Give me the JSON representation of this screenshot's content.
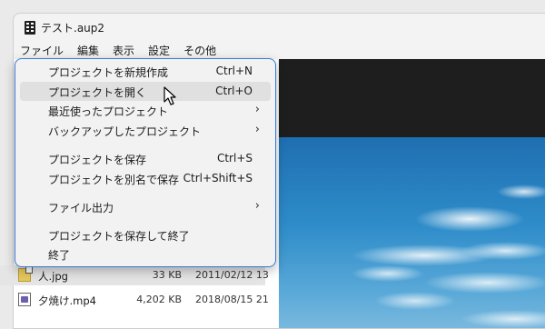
{
  "window": {
    "title": "テスト.aup2"
  },
  "menubar": {
    "items": [
      "ファイル",
      "編集",
      "表示",
      "設定",
      "その他"
    ]
  },
  "file_menu": {
    "new_project": {
      "label": "プロジェクトを新規作成",
      "shortcut": "Ctrl+N"
    },
    "open_project": {
      "label": "プロジェクトを開く",
      "shortcut": "Ctrl+O"
    },
    "recent_projects": {
      "label": "最近使ったプロジェクト",
      "arrow": "›"
    },
    "backup_projects": {
      "label": "バックアップしたプロジェクト",
      "arrow": "›"
    },
    "save_project": {
      "label": "プロジェクトを保存",
      "shortcut": "Ctrl+S"
    },
    "save_as": {
      "label": "プロジェクトを別名で保存",
      "shortcut": "Ctrl+Shift+S"
    },
    "file_export": {
      "label": "ファイル出力",
      "arrow": "›"
    },
    "save_and_exit": {
      "label": "プロジェクトを保存して終了"
    },
    "exit": {
      "label": "終了"
    }
  },
  "files": [
    {
      "name": "人.jpg",
      "size": "33 KB",
      "date": "2011/02/12 13",
      "icon": "jpg-file-icon"
    },
    {
      "name": "夕焼け.mp4",
      "size": "4,202 KB",
      "date": "2018/08/15 21",
      "icon": "mp4-file-icon"
    }
  ],
  "colors": {
    "accent": "#3a7bd5",
    "menu_bg": "#f2f2f2",
    "hover": "#e0e0e0"
  }
}
